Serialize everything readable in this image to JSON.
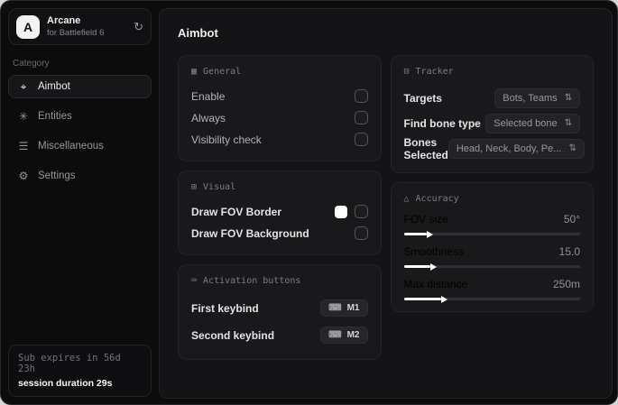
{
  "app": {
    "logo_letter": "A",
    "name": "Arcane",
    "subtitle": "for Battlefield 6"
  },
  "sidebar": {
    "category_label": "Category",
    "items": [
      {
        "label": "Aimbot",
        "active": true
      },
      {
        "label": "Entities",
        "active": false
      },
      {
        "label": "Miscellaneous",
        "active": false
      },
      {
        "label": "Settings",
        "active": false
      }
    ],
    "footer": {
      "line1": "Sub expires in 56d 23h",
      "line2": "session duration 29s"
    }
  },
  "page": {
    "title": "Aimbot"
  },
  "cards": {
    "general": {
      "title": "General",
      "rows": [
        {
          "label": "Enable",
          "checked": false
        },
        {
          "label": "Always",
          "checked": false
        },
        {
          "label": "Visibility check",
          "checked": false
        }
      ]
    },
    "visual": {
      "title": "Visual",
      "rows": [
        {
          "label": "Draw FOV Border",
          "swatch_color": "#ffffff",
          "checked": false
        },
        {
          "label": "Draw FOV Background",
          "checked": false
        }
      ]
    },
    "activation": {
      "title": "Activation buttons",
      "rows": [
        {
          "label": "First keybind",
          "key": "M1"
        },
        {
          "label": "Second keybind",
          "key": "M2"
        }
      ]
    },
    "tracker": {
      "title": "Tracker",
      "rows": [
        {
          "label": "Targets",
          "value": "Bots, Teams"
        },
        {
          "label": "Find bone type",
          "value": "Selected bone"
        },
        {
          "label": "Bones Selected",
          "value": "Head, Neck, Body, Pe..."
        }
      ]
    },
    "accuracy": {
      "title": "Accuracy",
      "rows": [
        {
          "label": "FOV size",
          "value": "50°",
          "percent": 13
        },
        {
          "label": "Smoothness",
          "value": "15.0",
          "percent": 15
        },
        {
          "label": "Max distance",
          "value": "250m",
          "percent": 21
        }
      ]
    }
  },
  "colors": {
    "fov_border_swatch": "#ffffff",
    "slider_fill": "#ffffff"
  }
}
